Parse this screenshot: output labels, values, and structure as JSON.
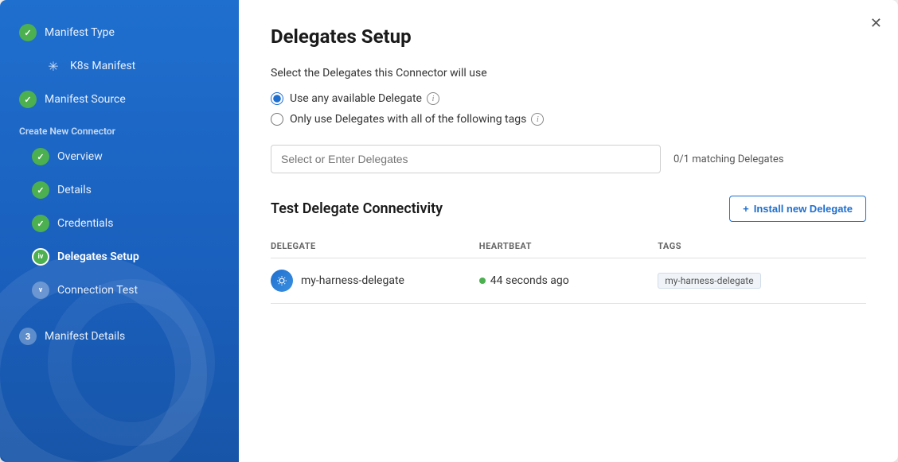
{
  "sidebar": {
    "items": [
      {
        "id": "manifest-type",
        "label": "Manifest Type",
        "status": "done",
        "stepNum": null,
        "icon": "check"
      },
      {
        "id": "k8s-manifest",
        "label": "K8s Manifest",
        "status": "sub",
        "icon": "snowflake"
      },
      {
        "id": "manifest-source",
        "label": "Manifest Source",
        "status": "done",
        "stepNum": null,
        "icon": "check"
      },
      {
        "id": "create-new-connector",
        "label": "Create New Connector",
        "status": "group-label"
      },
      {
        "id": "overview",
        "label": "Overview",
        "status": "done",
        "icon": "check"
      },
      {
        "id": "details",
        "label": "Details",
        "status": "done",
        "icon": "check"
      },
      {
        "id": "credentials",
        "label": "Credentials",
        "status": "done",
        "icon": "check"
      },
      {
        "id": "delegates-setup",
        "label": "Delegates Setup",
        "status": "active",
        "stepNum": "iv"
      },
      {
        "id": "connection-test",
        "label": "Connection Test",
        "status": "inactive",
        "stepNum": "v"
      }
    ],
    "bottom_item": {
      "label": "Manifest Details",
      "stepNum": "3"
    }
  },
  "main": {
    "title": "Delegates Setup",
    "description": "Select the Delegates this Connector will use",
    "radio_options": [
      {
        "id": "any-delegate",
        "label": "Use any available Delegate",
        "checked": true,
        "has_info": true
      },
      {
        "id": "specific-delegates",
        "label": "Only use Delegates with all of the following tags",
        "checked": false,
        "has_info": true
      }
    ],
    "delegate_input": {
      "placeholder": "Select or Enter Delegates",
      "value": ""
    },
    "matching_count": "0/1 matching Delegates",
    "test_section": {
      "title": "Test Delegate Connectivity",
      "install_btn_label": "Install new Delegate",
      "install_btn_icon": "+"
    },
    "table": {
      "columns": [
        {
          "id": "delegate",
          "label": "DELEGATE"
        },
        {
          "id": "heartbeat",
          "label": "HEARTBEAT"
        },
        {
          "id": "tags",
          "label": "TAGS"
        }
      ],
      "rows": [
        {
          "id": "my-harness-delegate",
          "name": "my-harness-delegate",
          "heartbeat": "44 seconds ago",
          "heartbeat_status": "green",
          "tag": "my-harness-delegate"
        }
      ]
    }
  },
  "icons": {
    "close": "✕",
    "check": "✓",
    "plus": "+",
    "snowflake": "✳",
    "delegate_snowflake": "❄"
  }
}
